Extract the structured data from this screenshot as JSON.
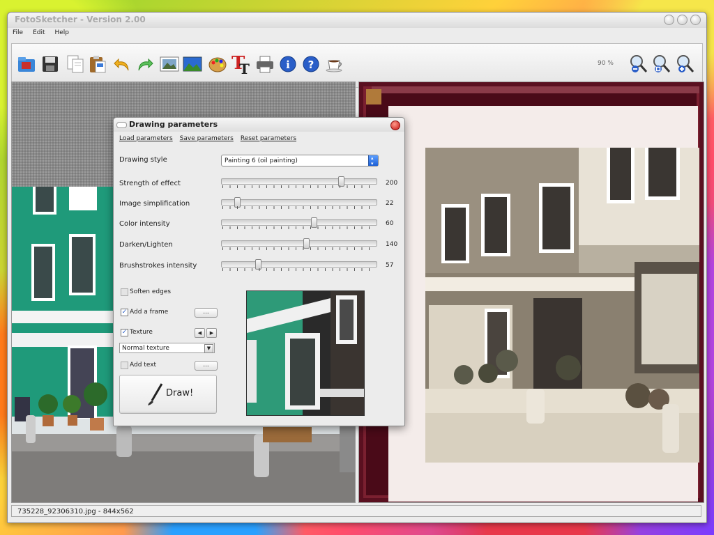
{
  "window": {
    "title": "FotoSketcher - Version 2.00"
  },
  "menu": [
    "File",
    "Edit",
    "Help"
  ],
  "toolbar": {
    "icons": [
      "open-folder-icon",
      "save-icon",
      "copy-icon",
      "paste-icon",
      "undo-icon",
      "redo-icon",
      "image-icon",
      "landscape-icon",
      "palette-icon",
      "text-icon",
      "print-icon",
      "info-icon",
      "help-icon",
      "coffee-icon",
      "zoom-out-icon",
      "zoom-fit-icon",
      "zoom-in-icon"
    ],
    "zoom": "90 %"
  },
  "status": {
    "text": "735228_92306310.jpg - 844x562"
  },
  "dialog": {
    "title": "Drawing parameters",
    "menu": [
      "Load parameters",
      "Save parameters",
      "Reset parameters"
    ],
    "style_label": "Drawing style",
    "style_value": "Painting 6 (oil painting)",
    "sliders": [
      {
        "label": "Strength of effect",
        "value": "200",
        "pos": 0.78
      },
      {
        "label": "Image simplification",
        "value": "22",
        "pos": 0.09
      },
      {
        "label": "Color intensity",
        "value": "60",
        "pos": 0.6
      },
      {
        "label": "Darken/Lighten",
        "value": "140",
        "pos": 0.55
      },
      {
        "label": "Brushstrokes intensity",
        "value": "57",
        "pos": 0.23
      }
    ],
    "soften_edges": "Soften edges",
    "add_frame": "Add a frame",
    "texture": "Texture",
    "texture_value": "Normal texture",
    "add_text": "Add text",
    "dots": "...",
    "draw": "Draw!"
  }
}
